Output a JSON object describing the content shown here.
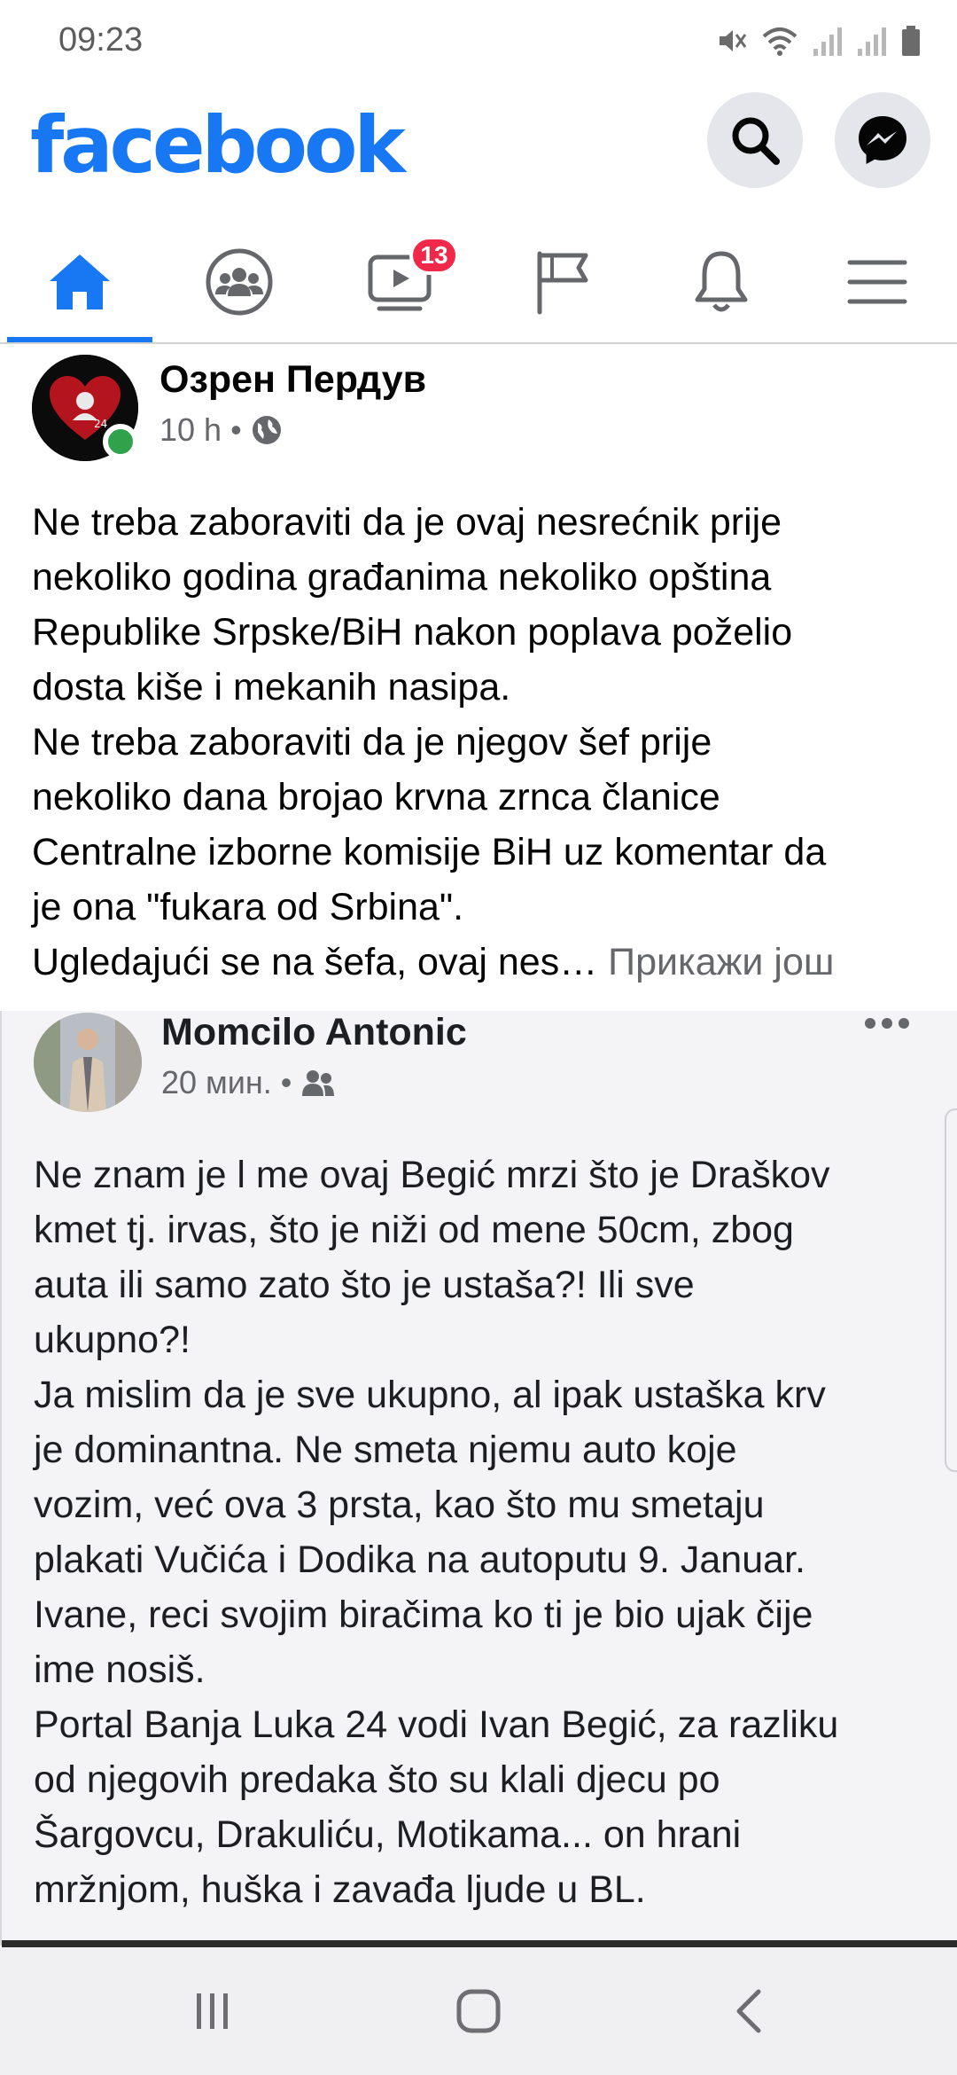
{
  "status_bar": {
    "time": "09:23",
    "icons": [
      "mute-icon",
      "wifi-icon",
      "signal-icon",
      "signal-icon",
      "battery-icon"
    ]
  },
  "header": {
    "logo_text": "facebook",
    "brand_color": "#1877f2"
  },
  "nav_tabs": [
    {
      "name": "home",
      "icon": "home-icon",
      "active": true
    },
    {
      "name": "groups",
      "icon": "groups-icon",
      "active": false
    },
    {
      "name": "watch",
      "icon": "video-icon",
      "active": false,
      "badge": "13"
    },
    {
      "name": "pages",
      "icon": "flag-icon",
      "active": false
    },
    {
      "name": "notifications",
      "icon": "bell-icon",
      "active": false
    },
    {
      "name": "menu",
      "icon": "menu-icon",
      "active": false
    }
  ],
  "post": {
    "author": "Озрен Пердув",
    "time": "10 h",
    "privacy_icon": "globe-icon",
    "lines": [
      "Ne treba zaboraviti da je ovaj nesrećnik prije",
      "nekoliko godina građanima nekoliko opština",
      "Republike Srpske/BiH nakon poplava poželio",
      "dosta kiše i mekanih nasipa.",
      "Ne treba zaboraviti da je njegov šef prije",
      "nekoliko dana brojao krvna zrnca članice",
      "Centralne izborne komisije BiH uz komentar da",
      "je ona \"fukara od Srbina\"."
    ],
    "last_line": "Ugledajući se na šefa, ovaj nes…",
    "see_more": "Прикажи још"
  },
  "shared_image": {
    "author": "Momcilo Antonic",
    "time": "20 мин.",
    "audience_icon": "friends-icon",
    "lines": [
      "Ne znam je l me ovaj Begić mrzi što je Draškov",
      "kmet tj. irvas, što je niži od mene 50cm, zbog",
      "auta ili samo zato što je ustaša?! Ili sve",
      "ukupno?!",
      "Ja mislim da je sve ukupno, al ipak ustaška krv",
      "je dominantna. Ne smeta njemu auto koje",
      "vozim, već ova 3 prsta, kao što mu smetaju",
      "plakati Vučića i Dodika na autoputu 9. Januar.",
      "Ivane, reci svojim biračima ko ti je bio ujak čije",
      "ime nosiš.",
      "Portal Banja Luka 24 vodi Ivan Begić, za razliku",
      "od njegovih predaka što su klali djecu po",
      "Šargovcu, Drakuliću, Motikama... on hrani",
      "mržnjom, huška i zavađa ljude u BL."
    ]
  },
  "system_nav": [
    "recents-icon",
    "home-circle-icon",
    "back-icon"
  ]
}
